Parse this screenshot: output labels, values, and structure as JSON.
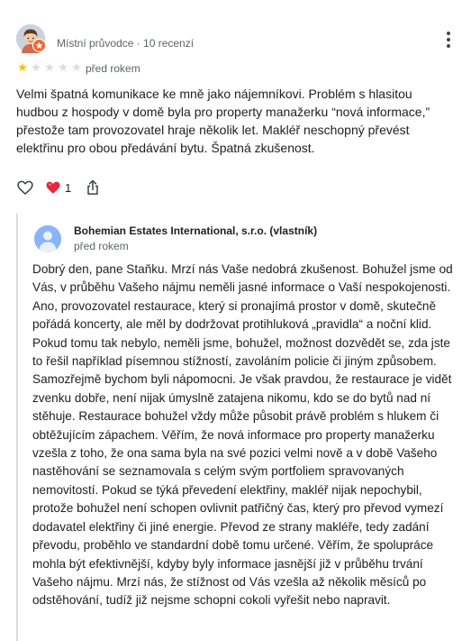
{
  "reviewer": {
    "meta": "Místní průvodce · 10 recenzí",
    "rating": 1,
    "max_rating": 5,
    "date": "před rokem",
    "text": "Velmi špatná komunikace ke mně jako nájemníkovi. Problém s hlasitou hudbou z hospody v domě byla pro property manažerku “nová informace,” přestože tam provozovatel hraje několik let. Makléř neschopný převést elektřinu pro obou předávání bytu. Špatná zkušenost."
  },
  "actions": {
    "reaction_count": "1",
    "like_icon": "heart-outline-icon",
    "reaction_icon": "red-heart-icon",
    "share_icon": "share-icon"
  },
  "owner_reply": {
    "name": "Bohemian Estates International, s.r.o. (vlastník)",
    "date": "před rokem",
    "text": "Dobrý den, pane Staňku. Mrzí nás Vaše nedobrá zkušenost. Bohužel jsme od Vás, v průběhu Vašeho nájmu neměli jasné informace o Vaší nespokojenosti. Ano, provozovatel restaurace, který si pronajímá prostor v domě, skutečně pořádá koncerty, ale měl by dodržovat protihluková „pravidla“ a noční klid. Pokud tomu tak nebylo, neměli jsme, bohužel, možnost dozvědět se, zda jste to řešil například písemnou stížností, zavoláním policie či jiným způsobem. Samozřejmě bychom byli nápomocni. Je však pravdou, že restaurace je vidět zvenku dobře, není nijak úmyslně zatajena nikomu, kdo se do bytů nad ní stěhuje. Restaurace bohužel vždy může působit právě problém s hlukem či obtěžujícím zápachem. Věřím, že nová informace pro property manažerku vzešla z toho, že ona sama byla na své pozici velmi nově a v době Vašeho nastěhování se seznamovala s celým svým portfoliem spravovaných nemovitostí. Pokud se týká převedení elektřiny, makléř nijak nepochybil, protože bohužel není schopen ovlivnit patřičný čas, který pro převod vymezí dodavatel elektřiny či jiné energie. Převod ze strany makléře, tedy zadání převodu, proběhlo ve standardní době tomu určené. Věřím, že spolupráce mohla být efektivnější, kdyby byly informace jasnější již v průběhu trvání Vašeho nájmu. Mrzí nás, že stížnost od Vás vzešla až několik měsíců po odstěhování, tudíž již nejsme schopni cokoli vyřešit nebo napravit."
  },
  "colors": {
    "star_on": "#fbbc04",
    "star_off": "#dadce0",
    "guide_badge": "#f06a35",
    "owner_avatar": "#8ab4f8"
  }
}
